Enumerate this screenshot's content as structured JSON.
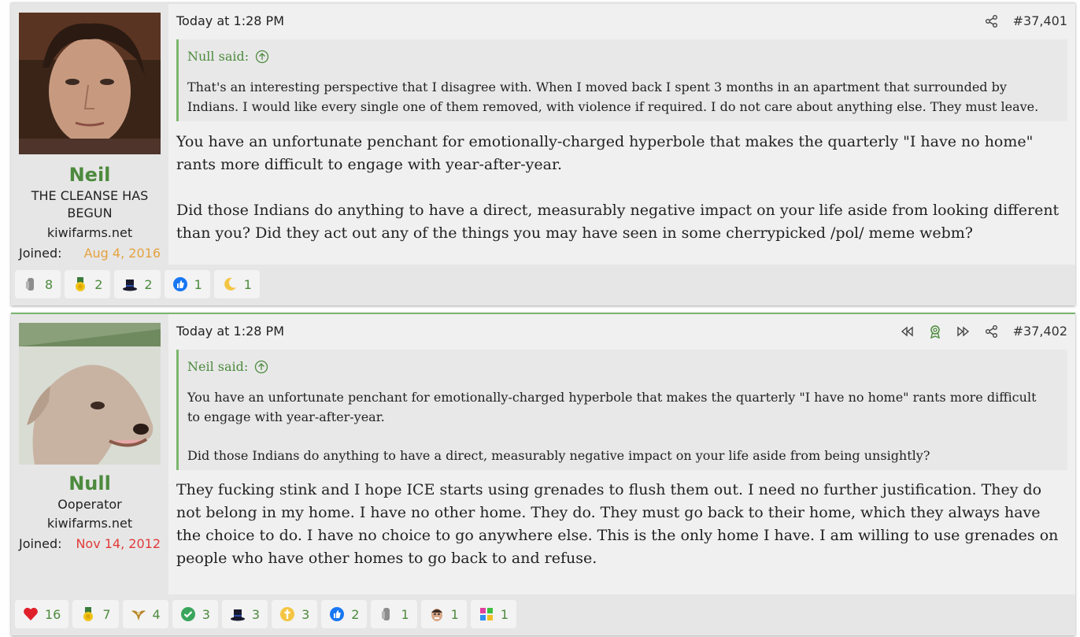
{
  "posts": [
    {
      "user": {
        "name": "Neil",
        "title": "THE CLEANSE HAS BEGUN",
        "site": "kiwifarms.net",
        "joined_label": "Joined:",
        "joined_date": "Aug 4, 2016",
        "joined_color": "#e5a23f"
      },
      "timestamp": "Today at 1:28 PM",
      "post_number": "#37,401",
      "quote": {
        "author": "Null said:",
        "text": "That's an interesting perspective that I disagree with. When I moved back I spent 3 months in an apartment that surrounded by Indians. I would like every single one of them removed, with violence if required. I do not care about anything else. They must leave."
      },
      "message": [
        "You have an unfortunate penchant for emotionally-charged hyperbole that makes the quarterly \"I have no home\" rants more difficult to engage with year-after-year.",
        "Did those Indians do anything to have a direct, measurably negative impact on your life aside from looking different than you? Did they act out any of the things you may have seen in some cherrypicked /pol/ meme webm?"
      ],
      "reactions": [
        {
          "icon": "robot-icon",
          "count": "8"
        },
        {
          "icon": "medal-icon",
          "count": "2"
        },
        {
          "icon": "top-hat-icon",
          "count": "2"
        },
        {
          "icon": "thumbs-up-icon",
          "count": "1"
        },
        {
          "icon": "moon-icon",
          "count": "1"
        }
      ]
    },
    {
      "user": {
        "name": "Null",
        "title": "Ooperator",
        "site": "kiwifarms.net",
        "joined_label": "Joined:",
        "joined_date": "Nov 14, 2012",
        "joined_color": "#e23a3a"
      },
      "timestamp": "Today at 1:28 PM",
      "post_number": "#37,402",
      "quote": {
        "author": "Neil said:",
        "text1": "You have an unfortunate penchant for emotionally-charged hyperbole that makes the quarterly \"I have no home\" rants more difficult to engage with year-after-year.",
        "text2": "Did those Indians do anything to have a direct, measurably negative impact on your life aside from being unsightly?"
      },
      "message": [
        "They fucking stink and I hope ICE starts using grenades to flush them out. I need no further justification. They do not belong in my home. I have no other home. They do. They must go back to their home, which they always have the choice to do. I have no choice to go anywhere else. This is the only home I have. I am willing to use grenades on people who have other homes to go back to and refuse."
      ],
      "reactions": [
        {
          "icon": "heart-icon",
          "count": "16"
        },
        {
          "icon": "medal-icon",
          "count": "7"
        },
        {
          "icon": "eagle-icon",
          "count": "4"
        },
        {
          "icon": "checkmark-icon",
          "count": "3"
        },
        {
          "icon": "top-hat-icon",
          "count": "3"
        },
        {
          "icon": "cross-icon",
          "count": "3"
        },
        {
          "icon": "thumbs-up-icon",
          "count": "2"
        },
        {
          "icon": "robot-icon",
          "count": "1"
        },
        {
          "icon": "face-icon",
          "count": "1"
        },
        {
          "icon": "puzzle-icon",
          "count": "1"
        }
      ]
    }
  ],
  "colors": {
    "accent": "#4d8a3e",
    "quote_border": "#7cb66e",
    "post_bg": "#f0f0f0",
    "user_bg": "#e6e6e6"
  }
}
